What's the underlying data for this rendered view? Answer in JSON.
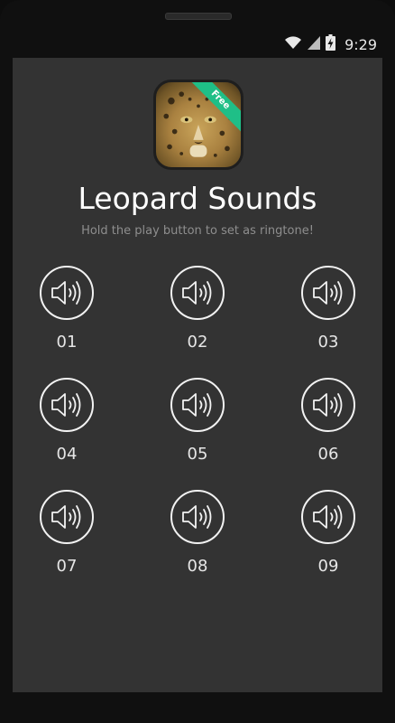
{
  "status_bar": {
    "wifi_icon": "wifi-icon",
    "signal_icon": "signal-icon",
    "battery_icon": "battery-charging-icon",
    "time": "9:29"
  },
  "app": {
    "badge": "Free",
    "title": "Leopard Sounds",
    "subtitle": "Hold the play button to set as ringtone!"
  },
  "sounds": [
    {
      "label": "01"
    },
    {
      "label": "02"
    },
    {
      "label": "03"
    },
    {
      "label": "04"
    },
    {
      "label": "05"
    },
    {
      "label": "06"
    },
    {
      "label": "07"
    },
    {
      "label": "08"
    },
    {
      "label": "09"
    }
  ],
  "colors": {
    "screen_bg": "#333333",
    "ribbon": "#1fbf87",
    "subtitle": "#8e8e8e"
  }
}
